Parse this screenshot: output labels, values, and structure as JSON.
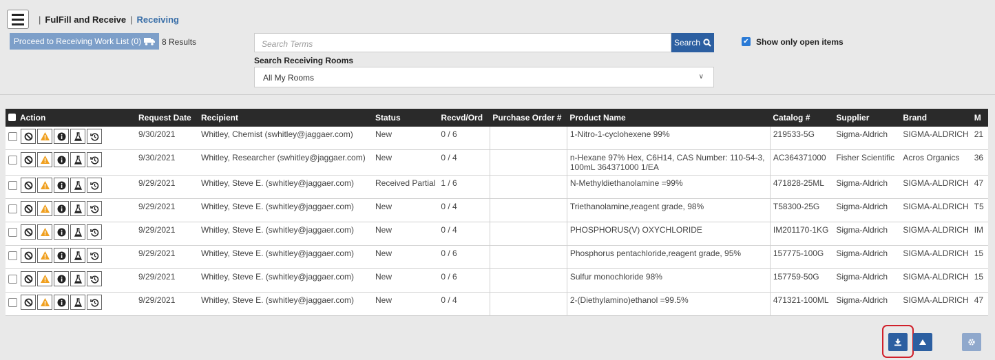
{
  "header": {
    "section": "FulFill and Receive",
    "separator": "|",
    "current": "Receiving"
  },
  "toolbar": {
    "proceed_label": "Proceed to Receiving Work List (0)",
    "results": "8 Results",
    "search_placeholder": "Search Terms",
    "search_button": "Search",
    "rooms_label": "Search Receiving Rooms",
    "rooms_selected": "All My Rooms",
    "show_open_label": "Show only open items",
    "show_open_checked": true
  },
  "table": {
    "headers": [
      "Action",
      "Request Date",
      "Recipient",
      "Status",
      "Recvd/Ord",
      "Purchase Order #",
      "Product Name",
      "Catalog #",
      "Supplier",
      "Brand",
      "M"
    ],
    "rows": [
      {
        "date": "9/30/2021",
        "recipient": "Whitley, Chemist (swhitley@jaggaer.com)",
        "status": "New",
        "recvd": "0 / 6",
        "po": "",
        "product": "1-Nitro-1-cyclohexene 99%",
        "catalog": "219533-5G",
        "supplier": "Sigma-Aldrich",
        "brand": "SIGMA-ALDRICH",
        "m": "21"
      },
      {
        "date": "9/30/2021",
        "recipient": "Whitley, Researcher (swhitley@jaggaer.com)",
        "status": "New",
        "recvd": "0 / 4",
        "po": "",
        "product": "n-Hexane 97% Hex, C6H14, CAS Number: 110-54-3, 100mL 364371000 1/EA",
        "catalog": "AC364371000",
        "supplier": "Fisher Scientific",
        "brand": "Acros Organics",
        "m": "36"
      },
      {
        "date": "9/29/2021",
        "recipient": "Whitley, Steve E. (swhitley@jaggaer.com)",
        "status": "Received Partial",
        "recvd": "1 / 6",
        "po": "",
        "product": "N-Methyldiethanolamine =99%",
        "catalog": "471828-25ML",
        "supplier": "Sigma-Aldrich",
        "brand": "SIGMA-ALDRICH",
        "m": "47"
      },
      {
        "date": "9/29/2021",
        "recipient": "Whitley, Steve E. (swhitley@jaggaer.com)",
        "status": "New",
        "recvd": "0 / 4",
        "po": "",
        "product": "Triethanolamine,reagent grade, 98%",
        "catalog": "T58300-25G",
        "supplier": "Sigma-Aldrich",
        "brand": "SIGMA-ALDRICH",
        "m": "T5"
      },
      {
        "date": "9/29/2021",
        "recipient": "Whitley, Steve E. (swhitley@jaggaer.com)",
        "status": "New",
        "recvd": "0 / 4",
        "po": "",
        "product": "PHOSPHORUS(V) OXYCHLORIDE",
        "catalog": "IM201170-1KG",
        "supplier": "Sigma-Aldrich",
        "brand": "SIGMA-ALDRICH",
        "m": "IM"
      },
      {
        "date": "9/29/2021",
        "recipient": "Whitley, Steve E. (swhitley@jaggaer.com)",
        "status": "New",
        "recvd": "0 / 6",
        "po": "",
        "product": "Phosphorus pentachloride,reagent grade, 95%",
        "catalog": "157775-100G",
        "supplier": "Sigma-Aldrich",
        "brand": "SIGMA-ALDRICH",
        "m": "15"
      },
      {
        "date": "9/29/2021",
        "recipient": "Whitley, Steve E. (swhitley@jaggaer.com)",
        "status": "New",
        "recvd": "0 / 6",
        "po": "",
        "product": "Sulfur monochloride 98%",
        "catalog": "157759-50G",
        "supplier": "Sigma-Aldrich",
        "brand": "SIGMA-ALDRICH",
        "m": "15"
      },
      {
        "date": "9/29/2021",
        "recipient": "Whitley, Steve E. (swhitley@jaggaer.com)",
        "status": "New",
        "recvd": "0 / 4",
        "po": "",
        "product": "2-(Diethylamino)ethanol =99.5%",
        "catalog": "471321-100ML",
        "supplier": "Sigma-Aldrich",
        "brand": "SIGMA-ALDRICH",
        "m": "47"
      }
    ]
  },
  "icons": {
    "menu": "hamburger-icon",
    "truck": "truck-icon",
    "search": "search-icon",
    "cancel": "ban-icon",
    "warning": "warning-icon",
    "info": "info-icon",
    "flask": "flask-icon",
    "history": "history-icon",
    "download": "download-icon",
    "upload": "upload-icon",
    "settings": "gear-icon"
  },
  "colors": {
    "primary": "#2c5fa1",
    "proceed": "#7d9fc9",
    "warning": "#f0a020",
    "header_bg": "#2a2a2a",
    "highlight": "#d0202a"
  }
}
